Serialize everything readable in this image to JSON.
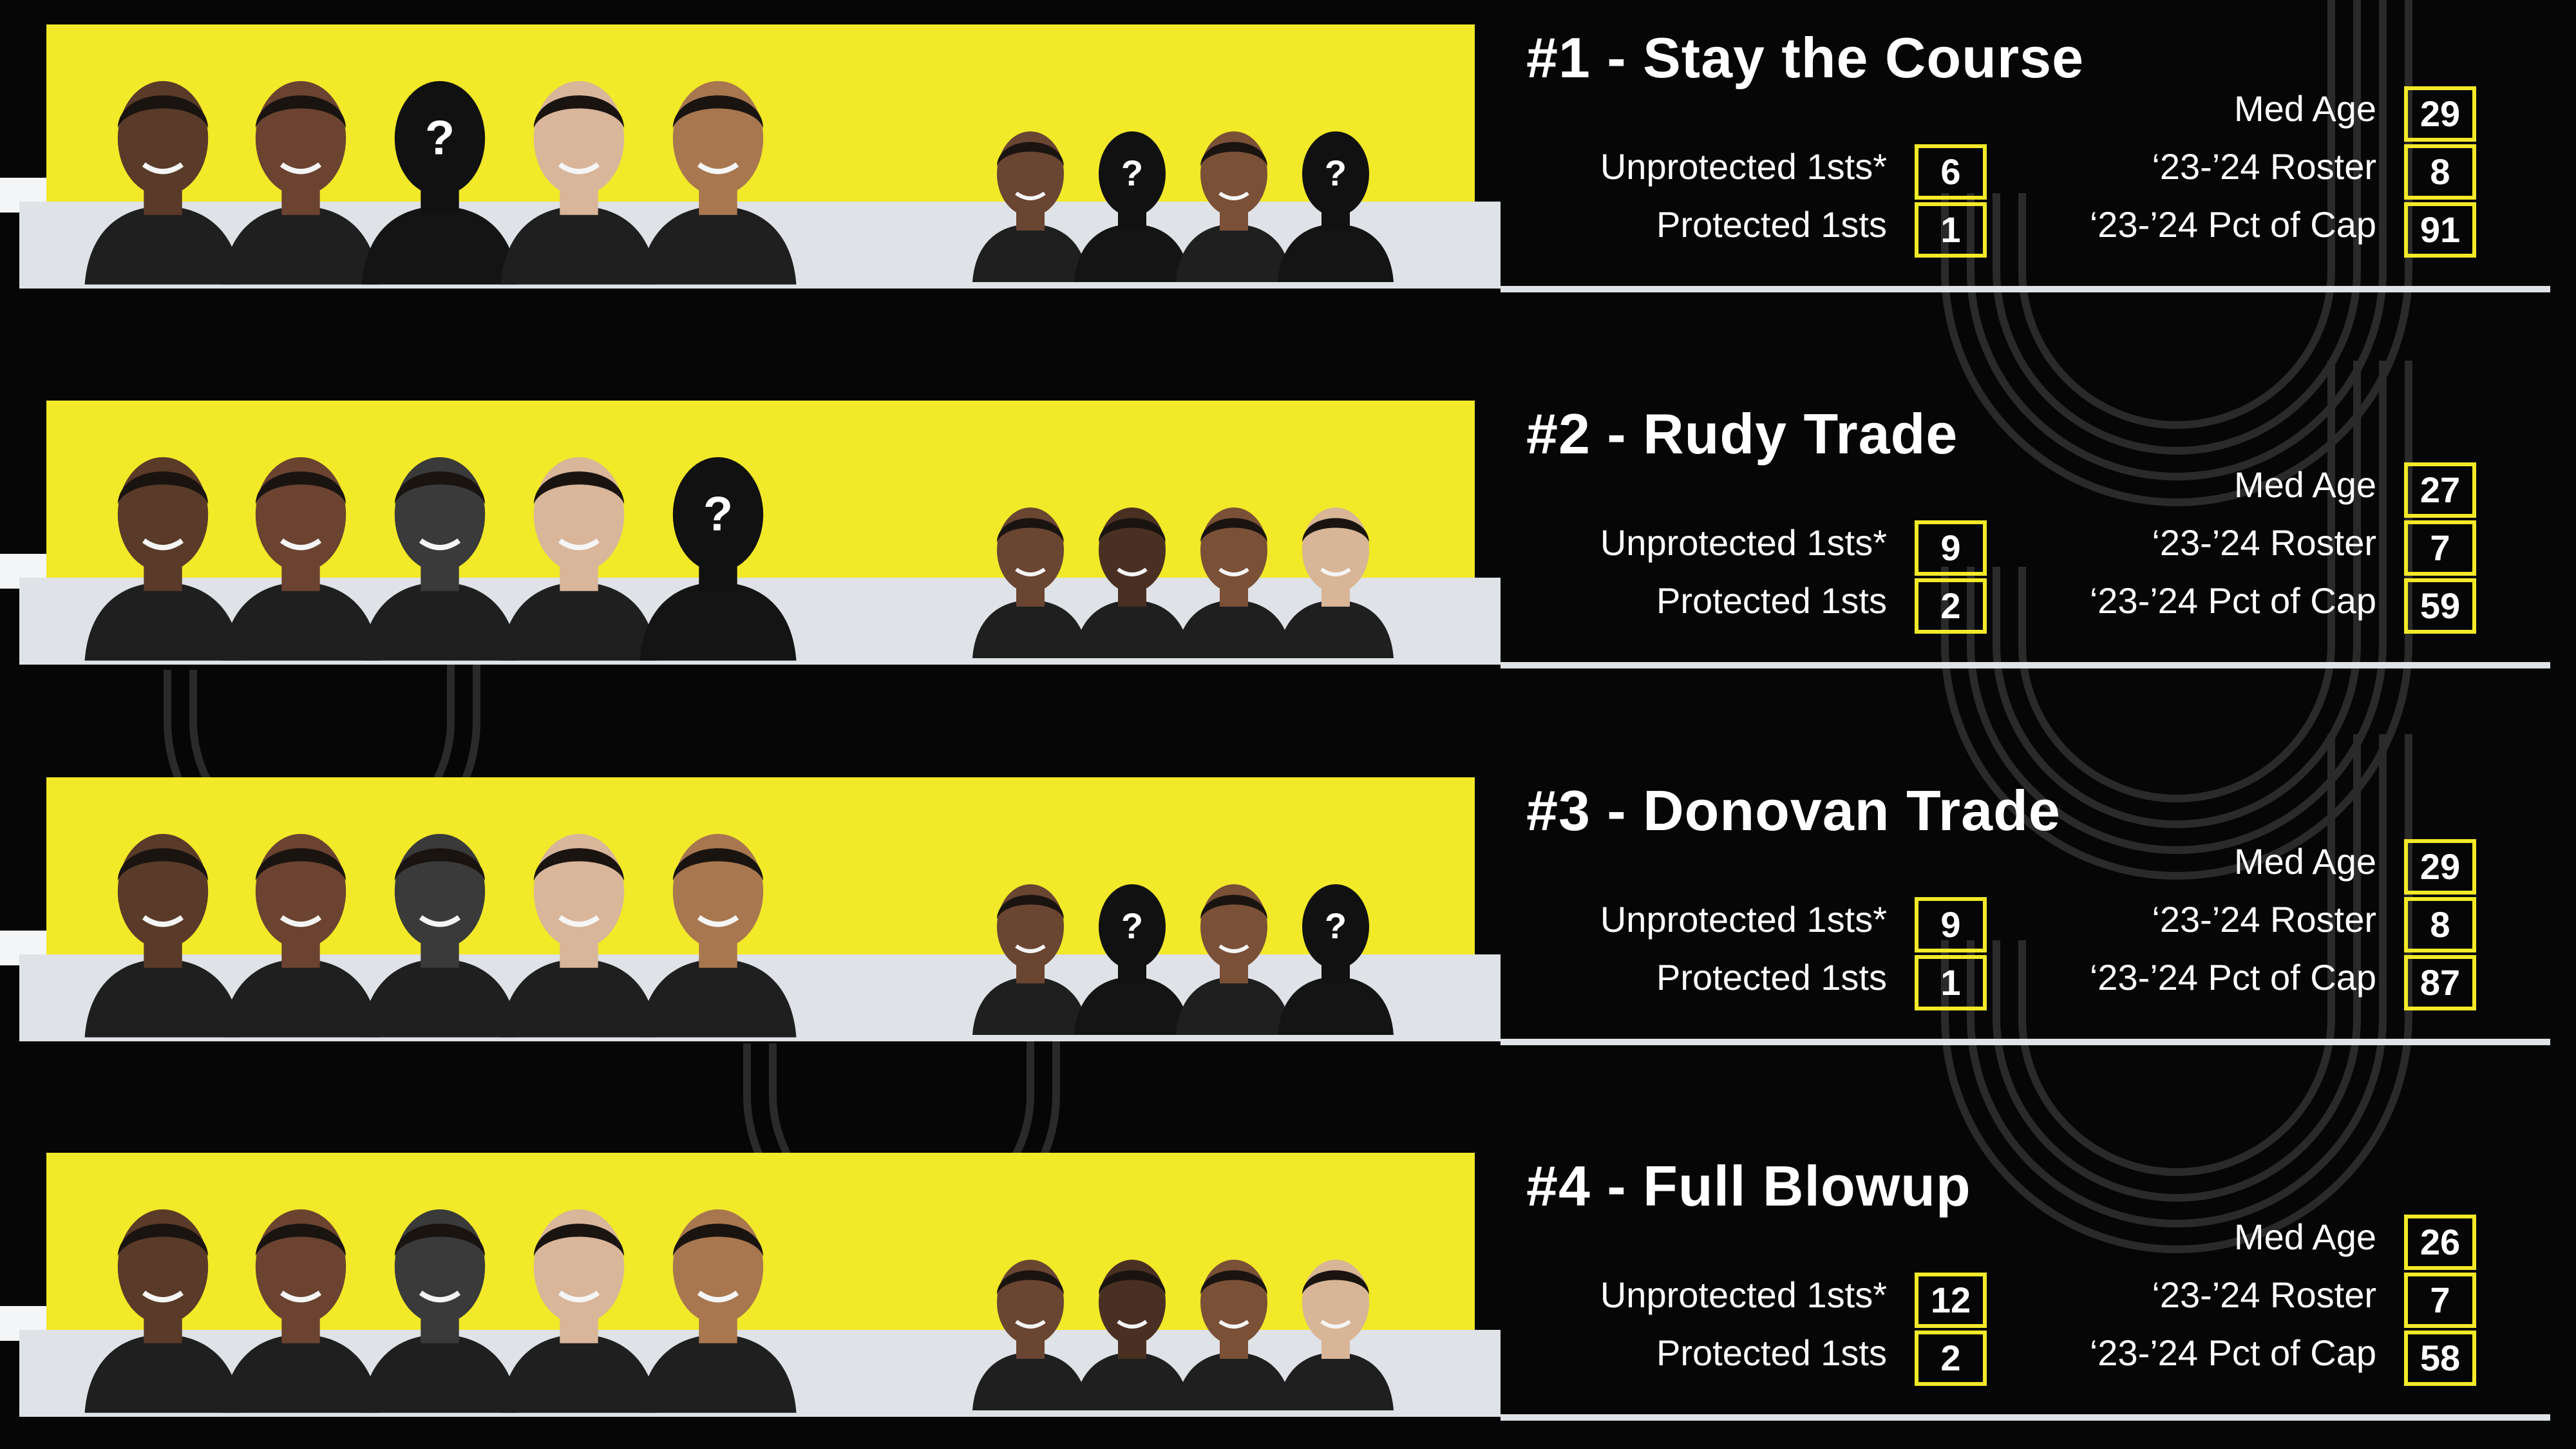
{
  "labels": {
    "unprotected": "Unprotected 1sts*",
    "protected": "Protected 1sts",
    "med_age": "Med Age",
    "roster": "‘23-’24 Roster",
    "pct_cap": "‘23-’24 Pct of Cap"
  },
  "unknown_player_mark": "?",
  "colors": {
    "accent": "#f2e928",
    "background": "#060606",
    "panel_grey": "#dfe2e6"
  },
  "scenarios": [
    {
      "title": "#1 - Stay the Course",
      "unprotected_firsts": "6",
      "protected_firsts": "1",
      "med_age": "29",
      "roster_count": "8",
      "pct_of_cap": "91",
      "main_players": [
        "player-photo",
        "player-photo",
        "unknown-player-silhouette",
        "player-photo",
        "player-photo"
      ],
      "bench_players": [
        "player-photo",
        "unknown-player-silhouette",
        "player-photo",
        "unknown-player-silhouette"
      ]
    },
    {
      "title": "#2 - Rudy Trade",
      "unprotected_firsts": "9",
      "protected_firsts": "2",
      "med_age": "27",
      "roster_count": "7",
      "pct_of_cap": "59",
      "main_players": [
        "player-photo",
        "player-photo",
        "player-photo",
        "player-photo",
        "unknown-player-silhouette"
      ],
      "bench_players": [
        "player-photo",
        "player-photo",
        "player-photo",
        "player-photo"
      ]
    },
    {
      "title": "#3 - Donovan Trade",
      "unprotected_firsts": "9",
      "protected_firsts": "1",
      "med_age": "29",
      "roster_count": "8",
      "pct_of_cap": "87",
      "main_players": [
        "player-photo",
        "player-photo",
        "player-photo",
        "player-photo",
        "player-photo"
      ],
      "bench_players": [
        "player-photo",
        "unknown-player-silhouette",
        "player-photo",
        "unknown-player-silhouette"
      ]
    },
    {
      "title": "#4 - Full Blowup",
      "unprotected_firsts": "12",
      "protected_firsts": "2",
      "med_age": "26",
      "roster_count": "7",
      "pct_of_cap": "58",
      "main_players": [
        "player-photo",
        "player-photo",
        "player-photo",
        "player-photo",
        "player-photo"
      ],
      "bench_players": [
        "player-photo",
        "player-photo",
        "player-photo",
        "player-photo"
      ]
    }
  ]
}
